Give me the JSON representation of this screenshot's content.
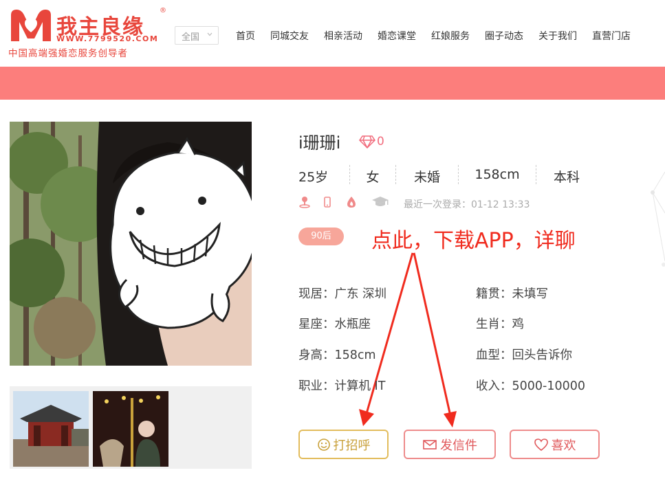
{
  "brand": {
    "name": "我主良缘",
    "url": "WWW.7799520.COM",
    "slogan": "中国高端强婚恋服务创导者",
    "reg": "®",
    "accent": "#e8463c"
  },
  "region": {
    "label": "全国"
  },
  "nav": [
    "首页",
    "同城交友",
    "相亲活动",
    "婚恋课堂",
    "红娘服务",
    "圈子动态",
    "关于我们",
    "直营门店"
  ],
  "profile": {
    "name": "i珊珊i",
    "diamonds": "0",
    "stats": [
      "25岁",
      "女",
      "未婚",
      "158cm",
      "本科"
    ],
    "last_login": "最近一次登录：01-12 13:33",
    "tag": "90后",
    "annotation": "点此，下载APP，详聊",
    "info": {
      "residence": "现居：广东 深圳",
      "hometown": "籍贯：未填写",
      "zodiac": "星座：水瓶座",
      "chinese_zodiac": "生肖：鸡",
      "height": "身高：158cm",
      "blood": "血型：回头告诉你",
      "job": "职业：计算机 IT",
      "income": "收入：5000-10000"
    },
    "buttons": {
      "hello": "打招呼",
      "mail": "发信件",
      "like": "喜欢"
    }
  },
  "icons": [
    "location-icon",
    "phone-icon",
    "drop-icon",
    "graduation-cap-icon",
    "diamond-icon",
    "smile-icon",
    "mail-icon",
    "heart-icon",
    "chevron-down-icon"
  ],
  "colors": {
    "banner": "#fc7e7c",
    "tag": "#f7a69a",
    "gold": "#c9a13b",
    "pink": "#e0585b",
    "annot": "#f02b1e"
  }
}
